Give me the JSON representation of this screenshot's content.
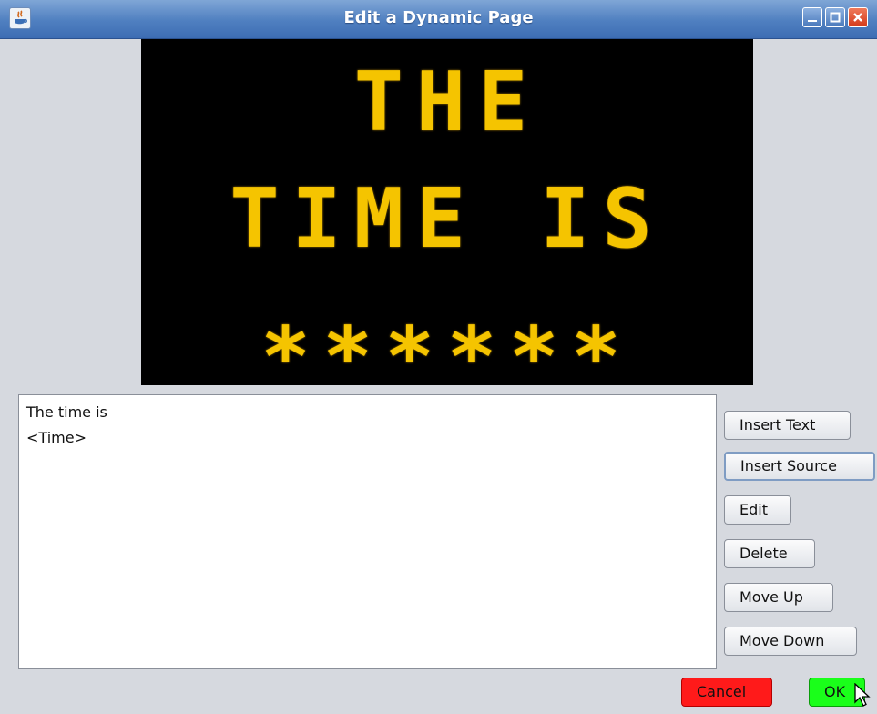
{
  "window": {
    "title": "Edit a Dynamic Page",
    "controls": [
      "minimize-icon",
      "maximize-icon",
      "close-icon"
    ]
  },
  "preview": {
    "lines": [
      "THE",
      "TIME IS",
      "******"
    ],
    "led_color": "#f5c400",
    "background": "#000000"
  },
  "message_list": {
    "items": [
      "The time is",
      "<Time>"
    ]
  },
  "buttons": {
    "insert_text": "Insert Text",
    "insert_source": "Insert Source",
    "edit": "Edit",
    "delete": "Delete",
    "move_up": "Move Up",
    "move_down": "Move Down",
    "cancel": "Cancel",
    "ok": "OK"
  },
  "colors": {
    "cancel": "#ff1a1a",
    "ok": "#1aff1a"
  }
}
